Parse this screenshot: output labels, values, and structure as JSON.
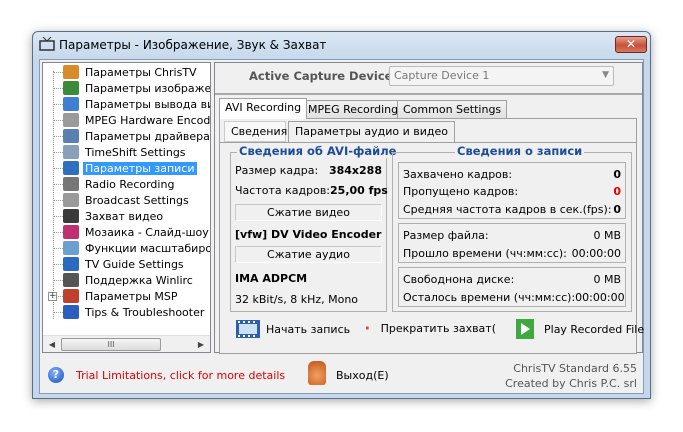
{
  "window": {
    "title": "Параметры - Изображение, Звук & Захват",
    "close_label": "✕"
  },
  "tree": {
    "items": [
      {
        "label": "Параметры ChrisTV",
        "color": "#d98a2a"
      },
      {
        "label": "Параметры изображения",
        "color": "#3a8a3a"
      },
      {
        "label": "Параметры вывода видео",
        "color": "#3f7fd0"
      },
      {
        "label": "MPEG Hardware Encoding",
        "color": "#9a9a9a"
      },
      {
        "label": "Параметры драйвера",
        "color": "#5a7fb0"
      },
      {
        "label": "TimeShift Settings",
        "color": "#8aa0b8"
      },
      {
        "label": "Параметры записи",
        "color": "#2f6fbf",
        "selected": true
      },
      {
        "label": "Radio Recording",
        "color": "#777777"
      },
      {
        "label": "Broadcast Settings",
        "color": "#9a9a9a"
      },
      {
        "label": "Захват видео",
        "color": "#3a3a3a"
      },
      {
        "label": "Мозаика - Слайд-шоу",
        "color": "#c03070"
      },
      {
        "label": "Функции масштабирования",
        "color": "#6aa0d0"
      },
      {
        "label": "TV Guide Settings",
        "color": "#2a6ac0"
      },
      {
        "label": "Поддержка Winlirc",
        "color": "#555555"
      },
      {
        "label": "Параметры MSP",
        "color": "#c04030"
      },
      {
        "label": "Tips & Troubleshooter",
        "color": "#2a5fc0"
      }
    ],
    "scroll_thumb": "III"
  },
  "device": {
    "label": "Active Capture Device :",
    "value": "Capture Device 1"
  },
  "tabs": [
    "AVI Recording",
    "MPEG Recording",
    "Common Settings"
  ],
  "subtabs": [
    "Сведения",
    "Параметры аудио и видео"
  ],
  "avi": {
    "title": "Сведения об AVI-файле",
    "frame_size_label": "Размер кадра:",
    "frame_size": "384x288",
    "fps_label": "Частота кадров:",
    "fps": "25,00 fps",
    "video_comp_label": "Сжатие видео",
    "video_codec": "[vfw] DV Video Encoder",
    "audio_comp_label": "Сжатие аудио",
    "audio_codec": "IMA ADPCM",
    "audio_format": "32 kBit/s, 8 kHz, Mono"
  },
  "rec": {
    "title": "Сведения о записи",
    "captured_label": "Захвачено кадров:",
    "captured": "0",
    "dropped_label": "Пропущено кадров:",
    "dropped": "0",
    "avgfps_label": "Средняя частота кадров в сек.(fps):",
    "avgfps": "0",
    "filesize_label": "Размер файла:",
    "filesize": "0 MB",
    "elapsed_label": "Прошло времени (чч:мм:сс):",
    "elapsed": "00:00:00",
    "free_label": "Свободнона диске:",
    "free": "0 MB",
    "remaining_label": "Осталось времени (чч:мм:сс):",
    "remaining": "00:00:00"
  },
  "actions": {
    "start": "Начать запись",
    "stop": "Прекратить захват(",
    "play": "Play Recorded File"
  },
  "footer": {
    "trial": "Trial Limitations, click for more details",
    "exit": "Выход(E)",
    "version": "ChrisTV Standard 6.55",
    "credit": "Created by Chris P.C. srl"
  },
  "colors": {
    "group_title": "#1b4d9a",
    "dropped": "#e00000",
    "trial": "#e00000",
    "selection": "#3399ff"
  }
}
